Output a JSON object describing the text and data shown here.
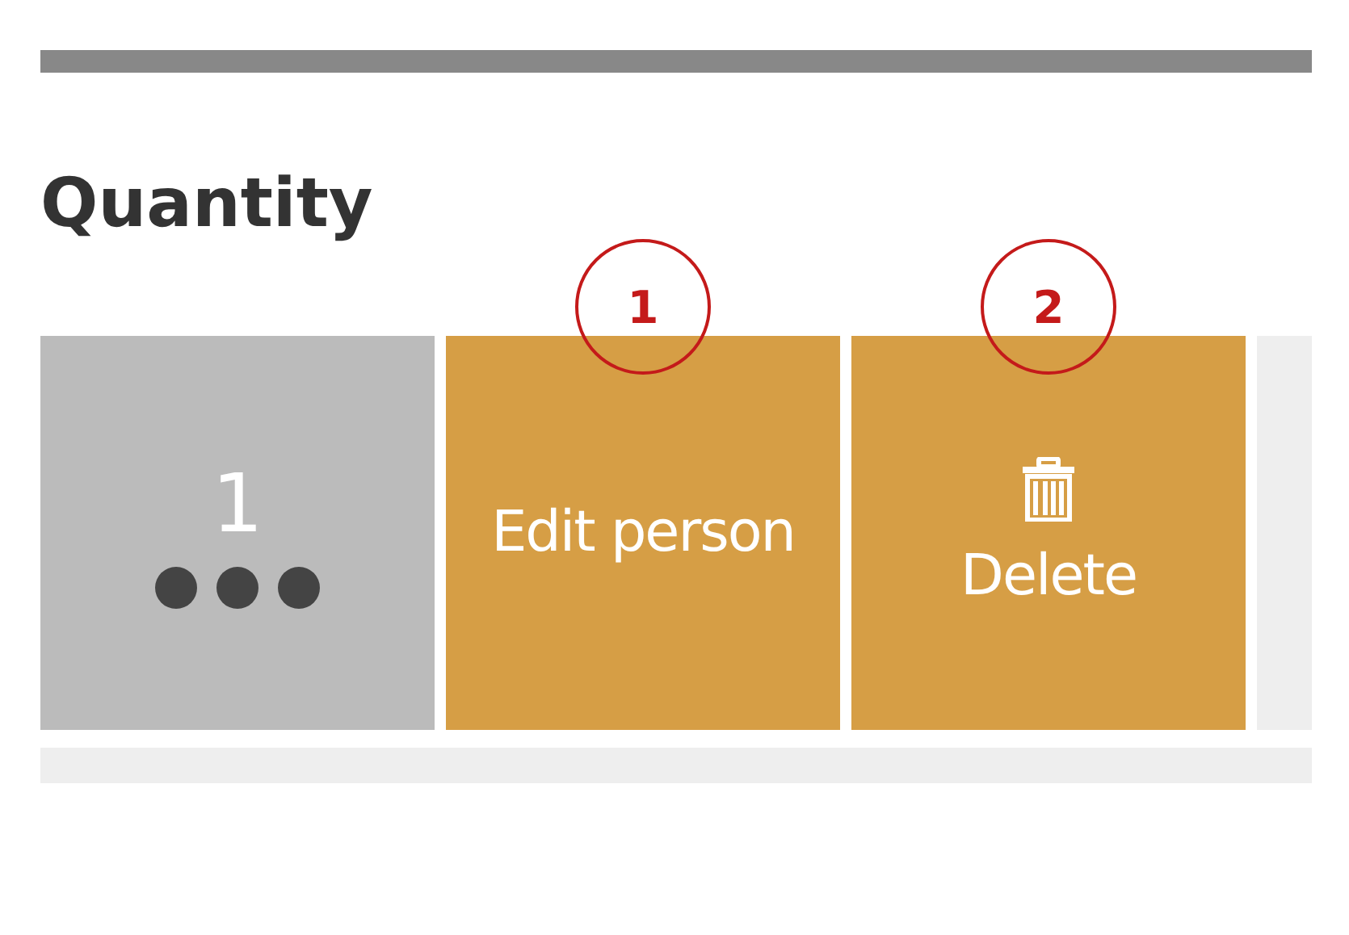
{
  "heading": "Quantity",
  "item": {
    "count": "1"
  },
  "actions": [
    {
      "kind": "edit",
      "label": "Edit person",
      "callout": "1"
    },
    {
      "kind": "delete",
      "label": "Delete",
      "callout": "2"
    }
  ]
}
